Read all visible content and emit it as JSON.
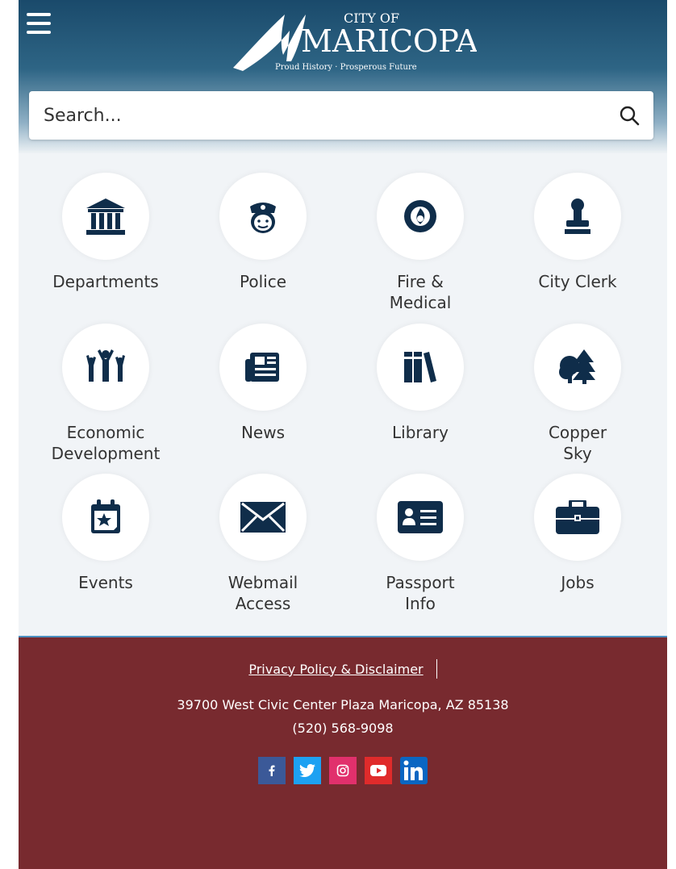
{
  "header": {
    "logo": {
      "line1": "CITY OF",
      "line2": "MARICOPA",
      "tagline": "Proud History · Prosperous Future"
    },
    "search": {
      "placeholder": "Search..."
    }
  },
  "tiles": [
    {
      "label": "Departments",
      "icon": "building-icon"
    },
    {
      "label": "Police",
      "icon": "police-officer-icon"
    },
    {
      "label": "Fire & Medical",
      "icon": "fire-medical-icon"
    },
    {
      "label": "City Clerk",
      "icon": "stamp-icon"
    },
    {
      "label": "Economic Development",
      "icon": "people-celebrate-icon"
    },
    {
      "label": "News",
      "icon": "newspaper-icon"
    },
    {
      "label": "Library",
      "icon": "books-icon"
    },
    {
      "label": "Copper Sky",
      "icon": "trees-icon"
    },
    {
      "label": "Events",
      "icon": "calendar-star-icon"
    },
    {
      "label": "Webmail Access",
      "icon": "envelope-icon"
    },
    {
      "label": "Passport Info",
      "icon": "id-card-icon"
    },
    {
      "label": "Jobs",
      "icon": "briefcase-icon"
    }
  ],
  "footer": {
    "privacy_label": "Privacy Policy & Disclaimer",
    "address": "39700 West Civic Center Plaza Maricopa, AZ 85138",
    "phone": "(520) 568-9098",
    "social": [
      {
        "name": "facebook",
        "color": "#3b5998"
      },
      {
        "name": "twitter",
        "color": "#1da1f2"
      },
      {
        "name": "instagram",
        "color": "#e1306c"
      },
      {
        "name": "youtube",
        "color": "#e02b2b"
      },
      {
        "name": "linkedin",
        "color": "#0a66c2"
      }
    ]
  },
  "colors": {
    "icon": "#0f2d4a",
    "footer_bg": "#782a2f",
    "header_top": "#1a4a6b"
  }
}
